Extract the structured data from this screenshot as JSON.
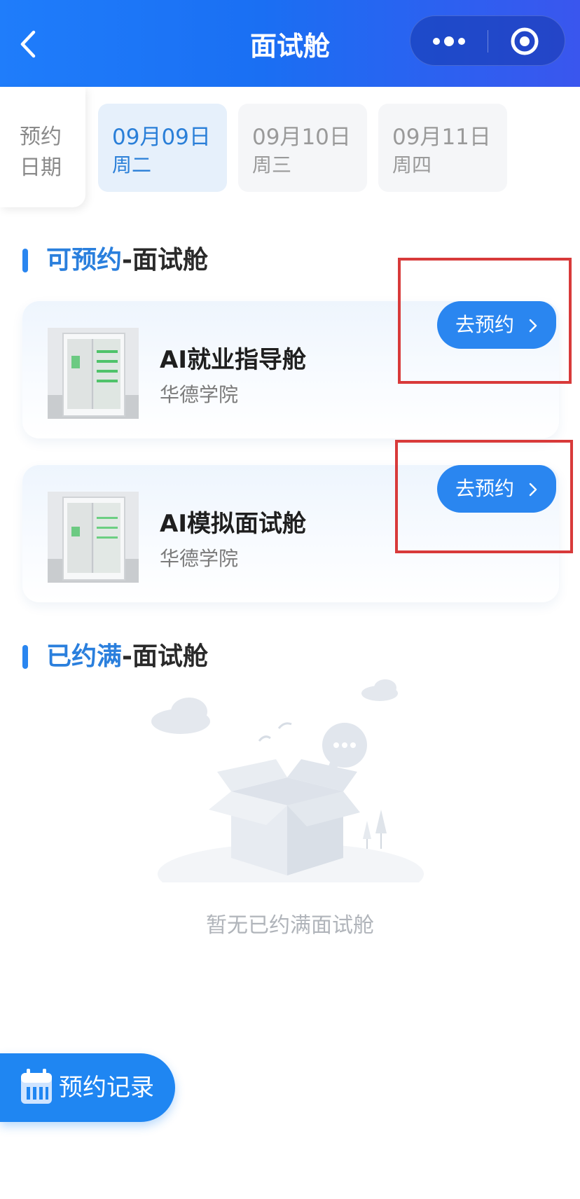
{
  "header": {
    "title": "面试舱",
    "back_icon": "chevron-left-icon",
    "more_icon": "more-dots-icon",
    "close_icon": "target-circle-icon"
  },
  "date_picker": {
    "label_line1": "预约",
    "label_line2": "日期",
    "dates": [
      {
        "date": "09月09日",
        "weekday": "周二",
        "selected": true
      },
      {
        "date": "09月10日",
        "weekday": "周三",
        "selected": false
      },
      {
        "date": "09月11日",
        "weekday": "周四",
        "selected": false
      }
    ]
  },
  "available_section": {
    "title_highlight": "可预约",
    "title_rest": "-面试舱"
  },
  "cabins": [
    {
      "name": "AI就业指导舱",
      "school": "华德学院",
      "button_label": "去预约"
    },
    {
      "name": "AI模拟面试舱",
      "school": "华德学院",
      "button_label": "去预约"
    }
  ],
  "full_section": {
    "title_highlight": "已约满",
    "title_rest": "-面试舱",
    "empty_text": "暂无已约满面试舱"
  },
  "floating": {
    "record_label": "预约记录"
  },
  "colors": {
    "accent": "#2a86f0",
    "header_start": "#1f7dfb",
    "header_end": "#3a56ee",
    "annotation_red": "#d83a3a"
  }
}
